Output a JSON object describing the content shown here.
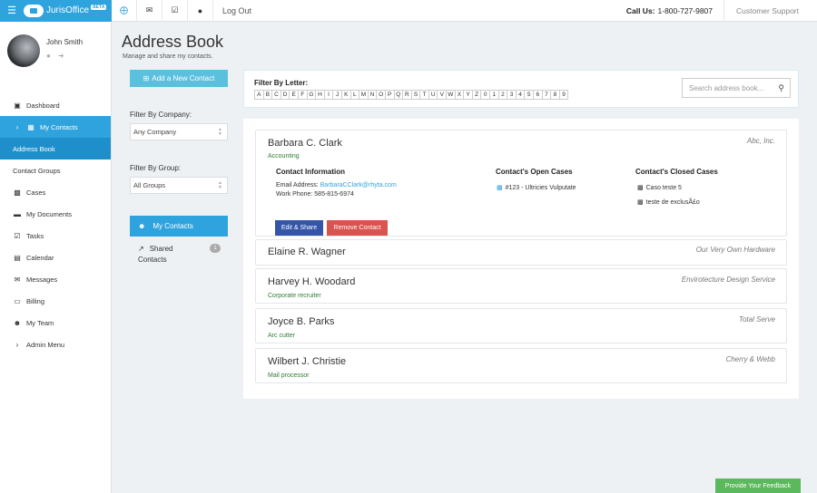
{
  "topbar": {
    "app_name": "JurisOffice",
    "beta": "BETA",
    "logout": "Log Out",
    "call_label": "Call Us:",
    "call_number": "1-800-727-9807",
    "support": "Customer Support",
    "icons": [
      "plus-circle-icon",
      "envelope-icon",
      "checkbox-icon",
      "user-icon"
    ]
  },
  "user": {
    "name": "John Smith"
  },
  "sidebar": {
    "items": [
      {
        "label": "Dashboard",
        "icon": "monitor-icon"
      },
      {
        "label": "My Contacts",
        "icon": "book-icon"
      },
      {
        "label": "Address Book",
        "icon": ""
      },
      {
        "label": "Contact Groups",
        "icon": ""
      },
      {
        "label": "Cases",
        "icon": "briefcase-icon"
      },
      {
        "label": "My Documents",
        "icon": "folder-icon"
      },
      {
        "label": "Tasks",
        "icon": "checkbox-icon"
      },
      {
        "label": "Calendar",
        "icon": "calendar-icon"
      },
      {
        "label": "Messages",
        "icon": "envelope-icon"
      },
      {
        "label": "Billing",
        "icon": "credit-card-icon"
      },
      {
        "label": "My Team",
        "icon": "team-icon"
      },
      {
        "label": "Admin Menu",
        "icon": "chevron-right-icon"
      }
    ]
  },
  "page": {
    "title": "Address Book",
    "subtitle": "Manage and share my contacts."
  },
  "filters": {
    "add_contact": "Add a New Contact",
    "company_label": "Filter By Company:",
    "company_value": "Any Company",
    "group_label": "Filter By Group:",
    "group_value": "All Groups",
    "my_contacts": "My Contacts",
    "shared_contacts": "Shared Contacts",
    "shared_count": "1",
    "letter_label": "Filter By Letter:",
    "letters": [
      "A",
      "B",
      "C",
      "D",
      "E",
      "F",
      "G",
      "H",
      "I",
      "J",
      "K",
      "L",
      "M",
      "N",
      "O",
      "P",
      "Q",
      "R",
      "S",
      "T",
      "U",
      "V",
      "W",
      "X",
      "Y",
      "Z",
      "0",
      "1",
      "2",
      "3",
      "4",
      "5",
      "6",
      "7",
      "8",
      "9"
    ],
    "search_placeholder": "Search address book..."
  },
  "contacts": [
    {
      "name": "Barbara C. Clark",
      "role": "Accounting",
      "company": "Abc, Inc.",
      "info_title": "Contact Information",
      "email_label": "Email Address:",
      "email": "BarbaraCClark@rhyta.com",
      "phone": "Work Phone: 585-815-6974",
      "open_title": "Contact's Open Cases",
      "open_cases": [
        "#123 - Ultricies Vulputate"
      ],
      "closed_title": "Contact's Closed Cases",
      "closed_cases": [
        "Caso teste 5",
        "teste de exclusÃ£o"
      ],
      "edit_label": "Edit & Share",
      "remove_label": "Remove Contact"
    },
    {
      "name": "Elaine R. Wagner",
      "role": "",
      "company": "Our Very Own Hardware"
    },
    {
      "name": "Harvey H. Woodard",
      "role": "Corporate recruiter",
      "company": "Envirotecture Design Service"
    },
    {
      "name": "Joyce B. Parks",
      "role": "Arc cutter",
      "company": "Total Serve"
    },
    {
      "name": "Wilbert J. Christie",
      "role": "Mail processor",
      "company": "Cherry & Webb"
    }
  ],
  "feedback": "Provide Your Feedback",
  "colors": {
    "accent": "#2fa3dd",
    "edit": "#3455a8",
    "remove": "#d9534f",
    "feedback": "#5cb85c",
    "role": "#2f7d32"
  }
}
